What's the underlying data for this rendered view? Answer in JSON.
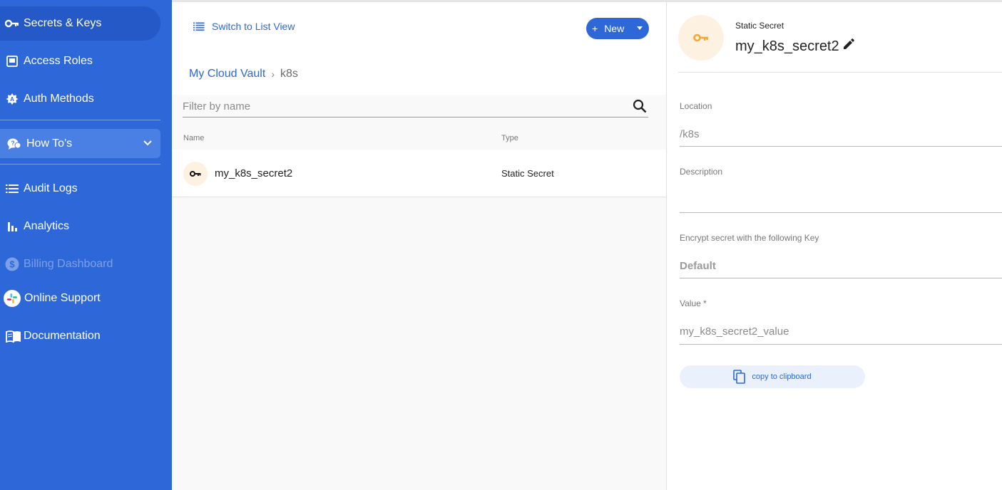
{
  "sidebar": {
    "items": [
      {
        "label": "Secrets & Keys",
        "icon": "key-icon"
      },
      {
        "label": "Access Roles",
        "icon": "access-roles-icon"
      },
      {
        "label": "Auth Methods",
        "icon": "auth-methods-icon"
      },
      {
        "label": "How To's",
        "icon": "question-chat-icon"
      },
      {
        "label": "Audit Logs",
        "icon": "list-icon"
      },
      {
        "label": "Analytics",
        "icon": "bar-chart-icon"
      },
      {
        "label": "Billing Dashboard",
        "icon": "dollar-icon"
      },
      {
        "label": "Online Support",
        "icon": "slack-icon"
      },
      {
        "label": "Documentation",
        "icon": "book-icon"
      }
    ]
  },
  "toolbar": {
    "switch_view_label": "Switch to List View",
    "new_label": "New",
    "new_plus": "+"
  },
  "breadcrumb": {
    "root": "My Cloud Vault",
    "separator": "›",
    "current": "k8s"
  },
  "filter": {
    "placeholder": "Filter by name"
  },
  "table": {
    "columns": [
      "Name",
      "Type"
    ],
    "rows": [
      {
        "name": "my_k8s_secret2",
        "type": "Static Secret",
        "icon": "key-icon"
      }
    ]
  },
  "details": {
    "kind": "Static Secret",
    "name": "my_k8s_secret2",
    "location_label": "Location",
    "location_value": "/k8s",
    "description_label": "Description",
    "description_value": "",
    "encrypt_label": "Encrypt secret with the following Key",
    "encrypt_value": "Default",
    "value_label": "Value *",
    "value_value": "my_k8s_secret2_value",
    "copy_label": "copy to clipboard"
  },
  "colors": {
    "sidebar_bg": "#2d67d8",
    "accent": "#2d67d8",
    "key_orange": "#f0a93a"
  }
}
